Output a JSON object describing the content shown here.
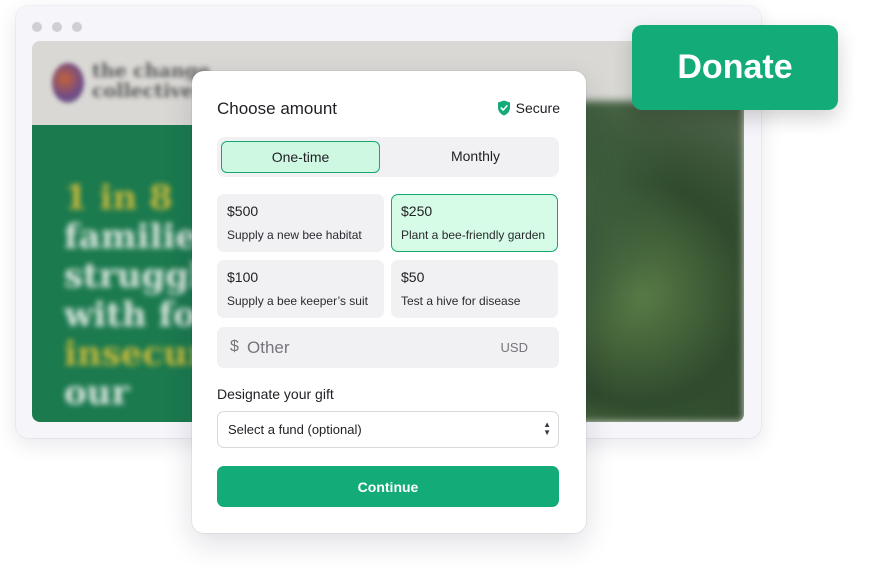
{
  "background_site": {
    "logo_text": "the change\ncollective",
    "hero_lines": [
      "1 in 8",
      "families",
      "struggle",
      "with food",
      "insecurity",
      "our"
    ]
  },
  "donate_badge": {
    "label": "Donate",
    "color": "#13ac79"
  },
  "form": {
    "title": "Choose amount",
    "secure_label": "Secure",
    "frequency": {
      "options": [
        "One-time",
        "Monthly"
      ],
      "selected": "One-time"
    },
    "amounts": [
      {
        "value": "$500",
        "description": "Supply a new bee habitat",
        "selected": false
      },
      {
        "value": "$250",
        "description": "Plant a bee-friendly garden",
        "selected": true
      },
      {
        "value": "$100",
        "description": "Supply a bee keeper’s suit",
        "selected": false
      },
      {
        "value": "$50",
        "description": "Test a hive for disease",
        "selected": false
      }
    ],
    "other": {
      "currency_symbol": "$",
      "placeholder": "Other",
      "currency": "USD"
    },
    "designate_label": "Designate your gift",
    "fund_select": {
      "selected": "Select a fund (optional)"
    },
    "continue_label": "Continue"
  },
  "colors": {
    "accent": "#13ac79",
    "selected_bg": "#d6fbe6",
    "hero_green": "#1b7a4e"
  }
}
